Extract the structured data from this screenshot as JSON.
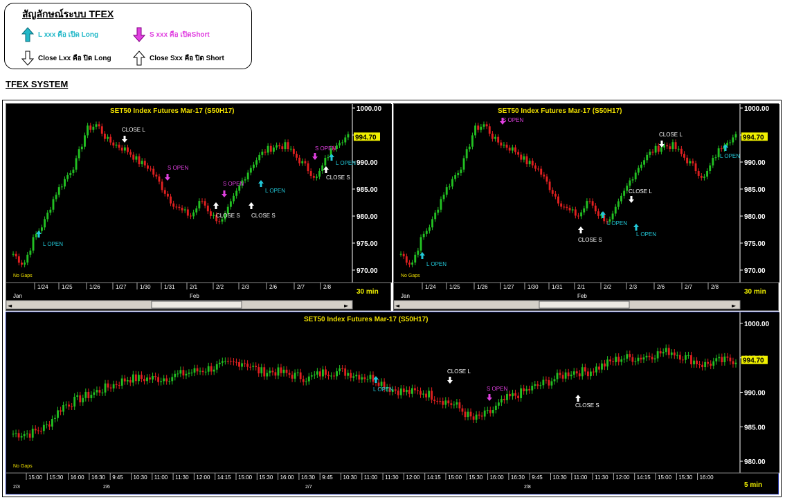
{
  "legend": {
    "title": "สัญลักษณ์ระบบ TFEX",
    "items": [
      {
        "label": "L xxx คือ เปิด Long",
        "color": "#22b8c8",
        "icon": "up-arrow-filled"
      },
      {
        "label": "S xxx คือ เปิดShort",
        "color": "#e040e0",
        "icon": "down-arrow-filled"
      },
      {
        "label": "Close Lxx คือ ปิด Long",
        "color": "#000000",
        "icon": "down-arrow-outline"
      },
      {
        "label": "Close Sxx คือ ปิด Short",
        "color": "#000000",
        "icon": "up-arrow-outline"
      }
    ]
  },
  "system_label": "TFEX SYSTEM",
  "colors": {
    "up": "#22c022",
    "down": "#e02020",
    "long": "#22c8d8",
    "short": "#e040e0",
    "price_box": "#f0f000",
    "title": "#f0e000"
  },
  "charts": [
    {
      "title": "SET50  Index  Futures  Mar-17  (S50H17)",
      "interval": "30  min",
      "last_price": "994.70",
      "no_gaps": "No Gaps",
      "price_ticks": [
        "1000.00",
        "995.00",
        "990.00",
        "985.00",
        "980.00",
        "975.00",
        "970.00"
      ],
      "date_ticks": [
        "1/24",
        "1/25",
        "1/26",
        "1/27",
        "1/30",
        "1/31",
        "2/1",
        "2/2",
        "2/3",
        "2/6",
        "2/7",
        "2/8"
      ],
      "month_ticks": [
        "Jan",
        "Feb"
      ],
      "signals": [
        "L  OPEN",
        "CLOSE  L",
        "S  OPEN",
        "S  OPEN",
        "CLOSE  S",
        "CLOSE  S",
        "L  OPEN",
        "S  OPEN",
        "L  OPEN",
        "CLOSE  S"
      ]
    },
    {
      "title": "SET50  Index  Futures  Mar-17  (S50H17)",
      "interval": "30  min",
      "last_price": "994.70",
      "no_gaps": "No Gaps",
      "price_ticks": [
        "1000.00",
        "995.00",
        "990.00",
        "985.00",
        "980.00",
        "975.00",
        "970.00"
      ],
      "date_ticks": [
        "1/24",
        "1/25",
        "1/26",
        "1/27",
        "1/30",
        "1/31",
        "2/1",
        "2/2",
        "2/3",
        "2/6",
        "2/7",
        "2/8"
      ],
      "month_ticks": [
        "Jan",
        "Feb"
      ],
      "signals": [
        "L  OPEN",
        "S  OPEN",
        "CLOSE  S",
        "L  OPEN",
        "CLOSE  L",
        "L  OPEN",
        "CLOSE  L",
        "L  OPEN"
      ]
    },
    {
      "title": "SET50  Index  Futures  Mar-17  (S50H17)",
      "interval": "5  min",
      "last_price": "994.70",
      "no_gaps": "No Gaps",
      "price_ticks": [
        "1000.00",
        "995.00",
        "990.00",
        "985.00",
        "980.00"
      ],
      "time_ticks": [
        "15:00",
        "15:30",
        "16:00",
        "16:30",
        "9:45",
        "10:30",
        "11:00",
        "11:30",
        "12:00",
        "14:15",
        "15:00",
        "15:30",
        "16:00",
        "16:30",
        "9:45",
        "10:30",
        "11:00",
        "11:30",
        "12:00",
        "14:15",
        "15:00",
        "15:30",
        "16:00",
        "16:30",
        "9:45",
        "10:30",
        "11:00",
        "11:30",
        "12:00",
        "14:15",
        "15:00",
        "15:30",
        "16:00"
      ],
      "day_ticks": [
        "2/3",
        "2/6",
        "2/7",
        "2/8"
      ],
      "signals": [
        "L  OPEN",
        "CLOSE  L",
        "S  OPEN",
        "CLOSE  S"
      ]
    }
  ]
}
